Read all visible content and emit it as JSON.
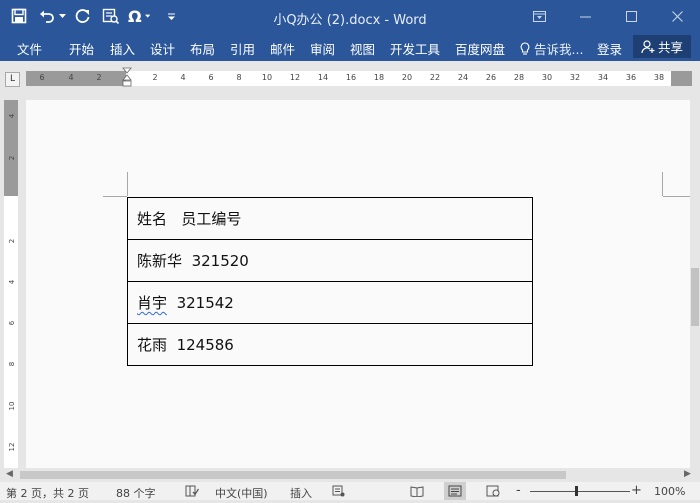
{
  "app": {
    "title": "小Q办公 (2).docx - Word",
    "accent": "#2b579a"
  },
  "qat": {
    "icons": [
      "save-icon",
      "undo-icon",
      "redo-icon",
      "print-preview-icon",
      "symbol-icon",
      "customize-icon"
    ],
    "symbol_label": "Ω"
  },
  "ribbon": {
    "tabs": [
      "文件",
      "开始",
      "插入",
      "设计",
      "布局",
      "引用",
      "邮件",
      "审阅",
      "视图",
      "开发工具",
      "百度网盘"
    ],
    "tell_me": "告诉我...",
    "login": "登录",
    "share": "共享"
  },
  "ruler": {
    "tab_selector": "L",
    "left_numbers": [
      "6",
      "4",
      "2"
    ],
    "right_numbers": [
      "2",
      "4",
      "6",
      "8",
      "10",
      "12",
      "14",
      "16",
      "18",
      "20",
      "22",
      "24",
      "26",
      "28",
      "30",
      "32",
      "34",
      "36",
      "38"
    ],
    "vertical_numbers": [
      "4",
      "2",
      "2",
      "4",
      "6",
      "8",
      "10",
      "12"
    ]
  },
  "table": {
    "rows": [
      [
        "姓名",
        "员工编号"
      ],
      [
        "陈新华",
        "321520"
      ],
      [
        "肖宇",
        "321542"
      ],
      [
        "花雨",
        "124586"
      ]
    ]
  },
  "status": {
    "page": "第 2 页，共 2 页",
    "words": "88 个字",
    "language": "中文(中国)",
    "mode": "插入",
    "zoom": "100%",
    "minus": "-",
    "plus": "+"
  }
}
